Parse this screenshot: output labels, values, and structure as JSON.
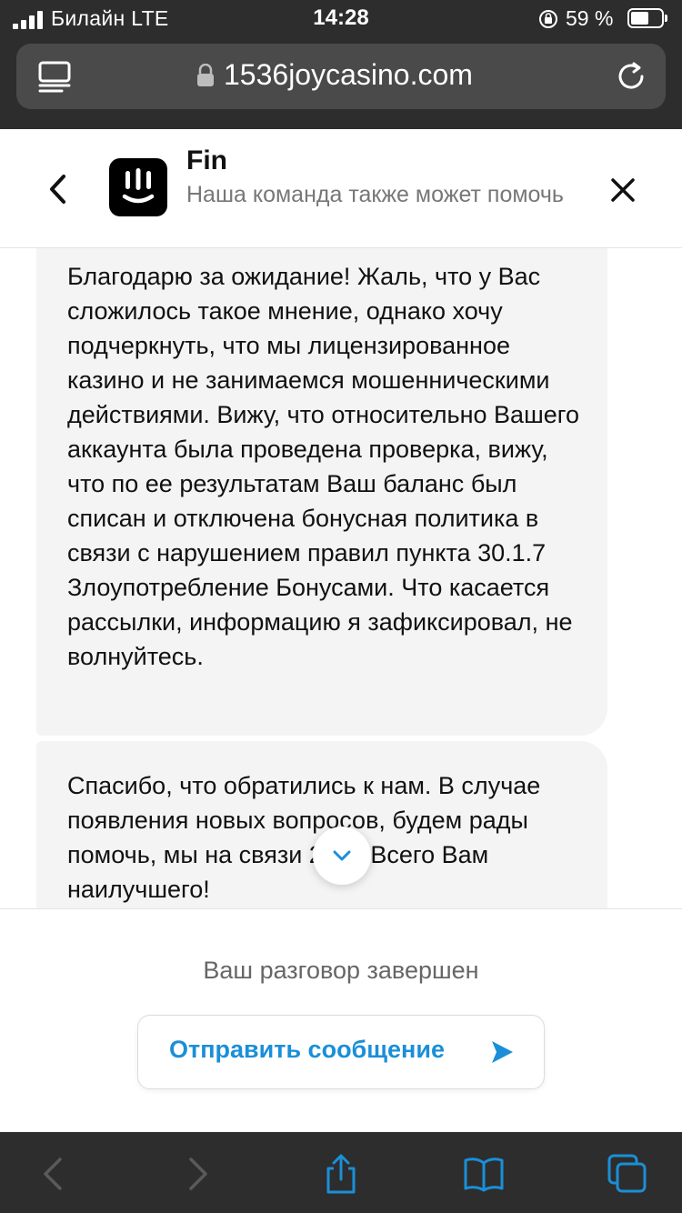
{
  "status_bar": {
    "carrier": "Билайн  LTE",
    "time": "14:28",
    "battery_percent": "59 %",
    "battery_level": 0.59
  },
  "browser": {
    "url": "1536joycasino.com"
  },
  "header": {
    "title": "Fin",
    "subtitle": "Наша команда также может помочь"
  },
  "messages": [
    {
      "text": "Благодарю за ожидание! Жаль, что у Вас сложилось такое мнение, однако хочу подчеркнуть, что мы лицензированное казино и не занимаемся мошенническими действиями. Вижу, что относительно Вашего аккаунта была проведена проверка, вижу, что по ее результатам Ваш баланс был списан и отключена бонусная политика в связи с нарушением правил пункта 30.1.7 Злоупотребление Бонусами. Что касается рассылки, информацию я зафиксировал, не волнуйтесь."
    },
    {
      "text": "Спасибо, что обратились к нам. В случае появления новых вопросов, будем рады помочь, мы на связи 24/7. Всего Вам наилучшего!"
    }
  ],
  "footer": {
    "ended_text": "Ваш разговор завершен",
    "send_label": "Отправить сообщение"
  },
  "colors": {
    "accent": "#1a8fd8",
    "chrome": "#2d2d2d",
    "toolbar_icon": "#1a8fd8",
    "toolbar_icon_disabled": "#5a5a5a"
  },
  "icons": {
    "reader": "reader-icon",
    "lock": "lock-icon",
    "reload": "reload-icon",
    "back": "chevron-left-icon",
    "close": "close-icon",
    "scroll_down": "chevron-down-icon",
    "send": "send-icon",
    "share": "share-icon",
    "bookmarks": "book-icon",
    "tabs": "tabs-icon"
  }
}
